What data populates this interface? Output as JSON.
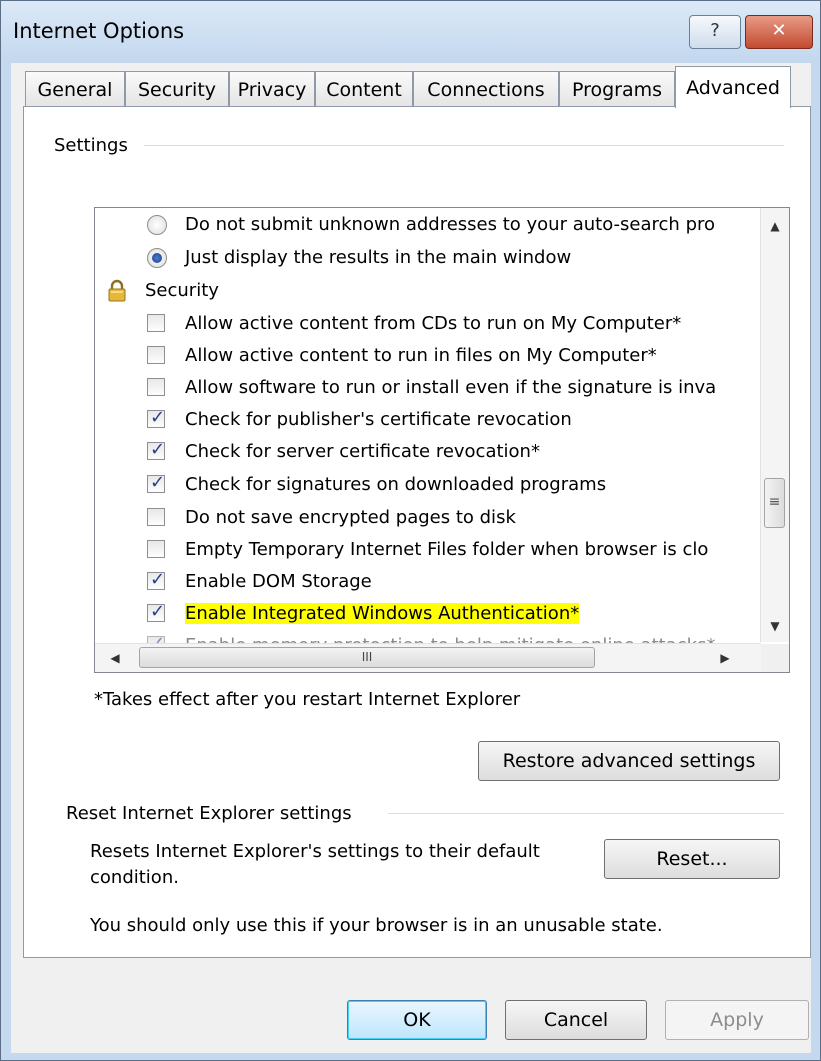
{
  "window": {
    "title": "Internet Options",
    "help_glyph": "?",
    "close_glyph": "✕"
  },
  "tabs": [
    "General",
    "Security",
    "Privacy",
    "Content",
    "Connections",
    "Programs",
    "Advanced"
  ],
  "active_tab": "Advanced",
  "settings": {
    "group_label": "Settings",
    "items": [
      {
        "type": "radio",
        "checked": false,
        "label": "Do not submit unknown addresses to your auto-search pro"
      },
      {
        "type": "radio",
        "checked": true,
        "label": "Just display the results in the main window"
      },
      {
        "type": "category",
        "icon": "lock-icon",
        "label": "Security"
      },
      {
        "type": "checkbox",
        "checked": false,
        "label": "Allow active content from CDs to run on My Computer*"
      },
      {
        "type": "checkbox",
        "checked": false,
        "label": "Allow active content to run in files on My Computer*"
      },
      {
        "type": "checkbox",
        "checked": false,
        "label": "Allow software to run or install even if the signature is inva"
      },
      {
        "type": "checkbox",
        "checked": true,
        "label": "Check for publisher's certificate revocation"
      },
      {
        "type": "checkbox",
        "checked": true,
        "label": "Check for server certificate revocation*"
      },
      {
        "type": "checkbox",
        "checked": true,
        "label": "Check for signatures on downloaded programs"
      },
      {
        "type": "checkbox",
        "checked": false,
        "label": "Do not save encrypted pages to disk"
      },
      {
        "type": "checkbox",
        "checked": false,
        "label": "Empty Temporary Internet Files folder when browser is clo"
      },
      {
        "type": "checkbox",
        "checked": true,
        "label": "Enable DOM Storage"
      },
      {
        "type": "checkbox",
        "checked": true,
        "label": "Enable Integrated Windows Authentication*",
        "highlighted": true
      },
      {
        "type": "checkbox",
        "checked": true,
        "label": "Enable memory protection to help mitigate online attacks*",
        "disabled": true
      }
    ],
    "hscroll_thumb_glyph": "III",
    "vscroll_thumb_glyph": "≡",
    "note": "*Takes effect after you restart Internet Explorer",
    "restore_button": "Restore advanced settings"
  },
  "reset": {
    "group_label": "Reset Internet Explorer settings",
    "description": "Resets Internet Explorer's settings to their default condition.",
    "description_line1": "Resets Internet Explorer's settings to their default",
    "description_line2": "condition.",
    "button": "Reset...",
    "warning": "You should only use this if your browser is in an unusable state."
  },
  "footer": {
    "ok": "OK",
    "cancel": "Cancel",
    "apply": "Apply"
  },
  "colors": {
    "highlight": "#ffff00",
    "check_mark": "#23438a",
    "close_button": "#c24a30"
  }
}
